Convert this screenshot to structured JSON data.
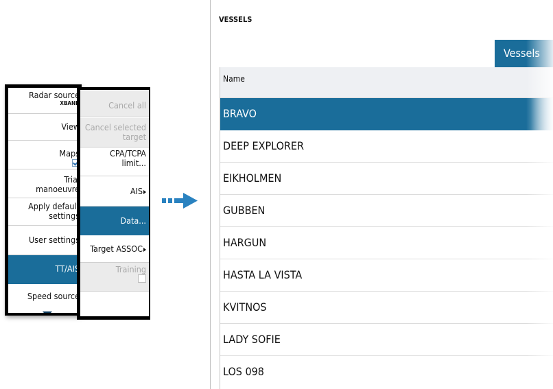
{
  "main_menu": {
    "radar_source_label": "Radar source",
    "radar_source_value": "XBAND",
    "view_label": "View",
    "maps_label": "Maps",
    "trial_label_line1": "Trial",
    "trial_label_line2": "manoeuvre",
    "apply_default_line1": "Apply default",
    "apply_default_line2": "settings",
    "user_settings_label": "User settings",
    "tt_ais_label": "TT/AIS",
    "speed_source_label": "Speed source"
  },
  "sub_menu": {
    "cancel_all_label": "Cancel all",
    "cancel_selected_line1": "Cancel selected",
    "cancel_selected_line2": "target",
    "cpa_line1": "CPA/TCPA",
    "cpa_line2": "limit...",
    "ais_label": "AIS",
    "data_label": "Data...",
    "target_assoc_label": "Target ASSOC",
    "training_label": "Training"
  },
  "vessels_panel": {
    "title": "VESSELS",
    "tab_label": "Vessels",
    "column_name": "Name",
    "vessels": [
      "BRAVO",
      "DEEP EXPLORER",
      "EIKHOLMEN",
      "GUBBEN",
      "HARGUN",
      "HASTA LA VISTA",
      "KVITNOS",
      "LADY SOFIE",
      "LOS 098"
    ]
  },
  "colors": {
    "accent": "#1a6d9a",
    "frame": "#000000",
    "disabled_bg": "#ebebeb",
    "flow_arrow": "#2a82c0"
  }
}
